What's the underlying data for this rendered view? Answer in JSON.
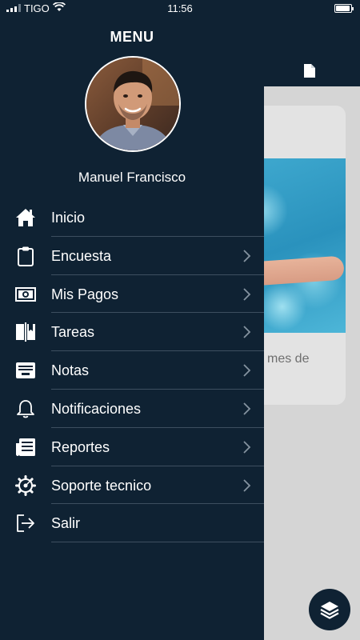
{
  "status_bar": {
    "carrier": "TIGO",
    "time": "11:56",
    "battery_level": 0.85
  },
  "drawer": {
    "title": "MENU",
    "user_name": "Manuel Francisco",
    "items": [
      {
        "label": "Inicio",
        "icon": "home-icon",
        "chevron": false
      },
      {
        "label": "Encuesta",
        "icon": "clipboard-icon",
        "chevron": true
      },
      {
        "label": "Mis Pagos",
        "icon": "money-icon",
        "chevron": true
      },
      {
        "label": "Tareas",
        "icon": "book-icon",
        "chevron": true
      },
      {
        "label": "Notas",
        "icon": "inbox-icon",
        "chevron": true
      },
      {
        "label": "Notificaciones",
        "icon": "bell-icon",
        "chevron": true
      },
      {
        "label": "Reportes",
        "icon": "newspaper-icon",
        "chevron": true
      },
      {
        "label": "Soporte tecnico",
        "icon": "gear-icon",
        "chevron": true
      },
      {
        "label": "Salir",
        "icon": "logout-icon",
        "chevron": false
      }
    ]
  },
  "background": {
    "card_text": "mes de",
    "fab_icon": "layers-icon",
    "header_icon": "document-icon"
  },
  "colors": {
    "drawer_bg": "#0f2233",
    "divider": "#3d4f60",
    "overlay": "#d5d5d5"
  }
}
